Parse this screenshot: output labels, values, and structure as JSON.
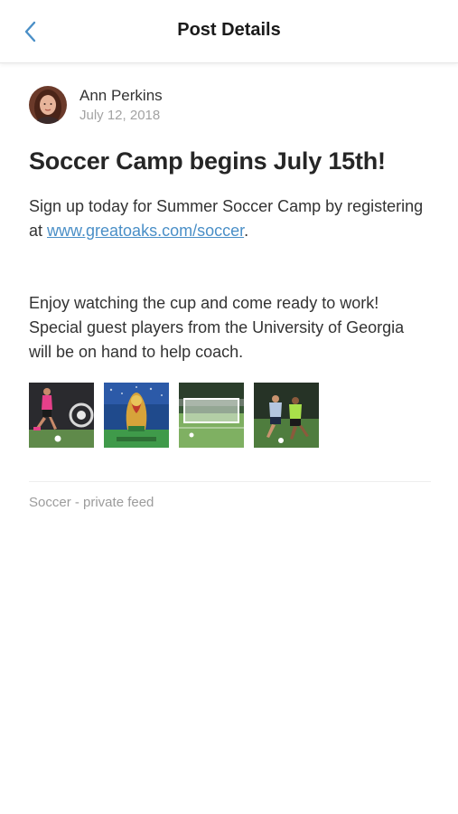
{
  "header": {
    "title": "Post Details",
    "back_icon": "chevron-left-icon",
    "accent": "#4a8fc7"
  },
  "post": {
    "author": "Ann Perkins",
    "date": "July 12, 2018",
    "title": "Soccer Camp begins July 15th!",
    "body1_prefix": "Sign up today for Summer Soccer Camp by registering at ",
    "body1_link": "www.greatoaks.com/soccer",
    "body1_suffix": ".",
    "body2": "Enjoy watching the cup and come ready to work! Special guest players from the University of Georgia will be on hand to help coach.",
    "images": [
      {
        "name": "player-kicking-photo"
      },
      {
        "name": "world-cup-trophy-photo"
      },
      {
        "name": "soccer-goal-photo"
      },
      {
        "name": "players-match-photo"
      }
    ],
    "feed": "Soccer - private feed"
  }
}
